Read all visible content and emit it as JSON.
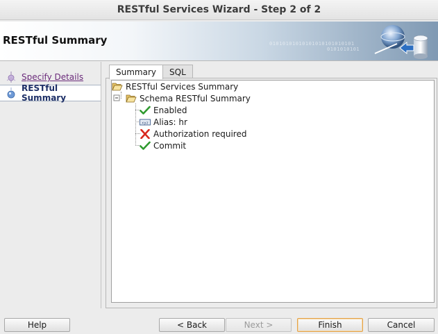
{
  "window": {
    "title": "RESTful Services Wizard - Step 2 of 2"
  },
  "banner": {
    "heading": "RESTful Summary",
    "binary_1": "01010101010101010101010101",
    "binary_2": "0101010101"
  },
  "nav": {
    "items": [
      {
        "label": "Specify Details",
        "state": "done"
      },
      {
        "label": "RESTful Summary",
        "state": "current"
      }
    ]
  },
  "tabs": [
    {
      "label": "Summary",
      "active": true
    },
    {
      "label": "SQL",
      "active": false
    }
  ],
  "tree": {
    "root": {
      "label": "RESTful Services Summary",
      "icon": "folder-open-icon"
    },
    "schema": {
      "label": "Schema RESTful Summary",
      "icon": "folder-open-icon"
    },
    "children": [
      {
        "label": "Enabled",
        "icon": "checkmark-icon"
      },
      {
        "label": "Alias: hr",
        "icon": "text-field-icon"
      },
      {
        "label": "Authorization required",
        "icon": "x-mark-icon"
      },
      {
        "label": "Commit",
        "icon": "checkmark-icon"
      }
    ]
  },
  "buttons": {
    "help": "Help",
    "back": "< Back",
    "next": "Next >",
    "finish": "Finish",
    "cancel": "Cancel"
  },
  "colors": {
    "accent_focus": "#e3a24a",
    "nav_visited": "#6a2a7a",
    "nav_current": "#1c2e66",
    "check_green": "#2f9a2f",
    "x_red": "#d8281e"
  }
}
